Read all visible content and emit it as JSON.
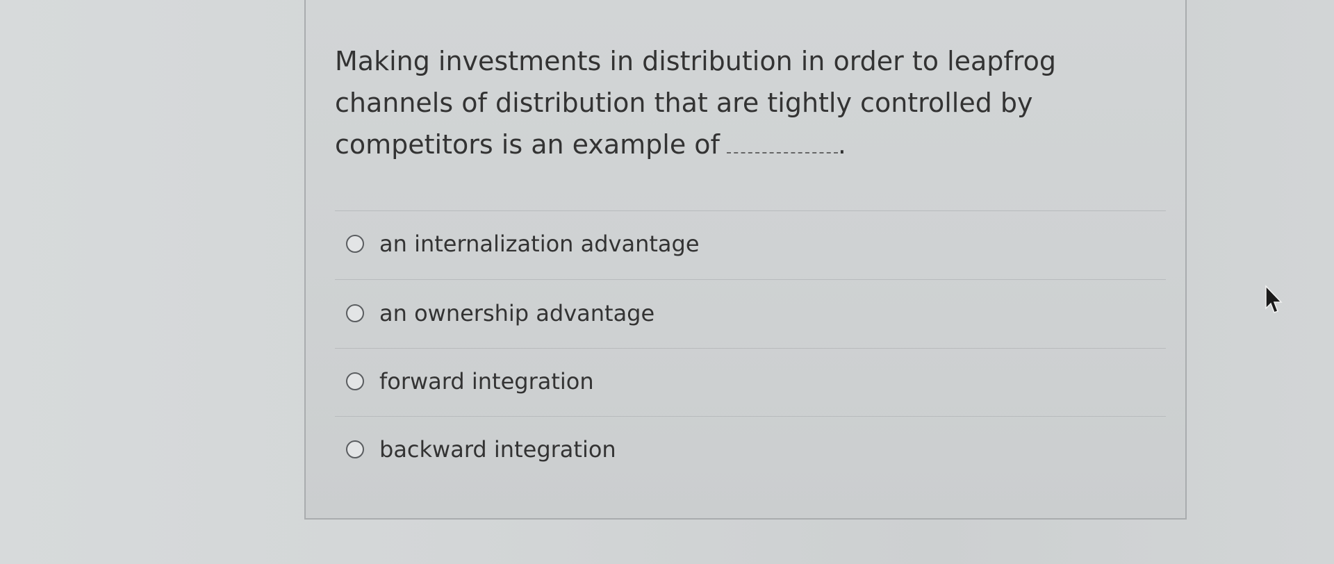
{
  "question": {
    "text": "Making investments in distribution in order to leapfrog channels of distribution that are tightly controlled by competitors is an example of",
    "blank_suffix": "."
  },
  "options": [
    {
      "label": "an internalization advantage",
      "selected": false
    },
    {
      "label": "an ownership advantage",
      "selected": false
    },
    {
      "label": "forward integration",
      "selected": false
    },
    {
      "label": "backward integration",
      "selected": false
    }
  ],
  "icons": {
    "option_marker": "radio-button-icon",
    "pointer": "mouse-cursor-icon"
  }
}
